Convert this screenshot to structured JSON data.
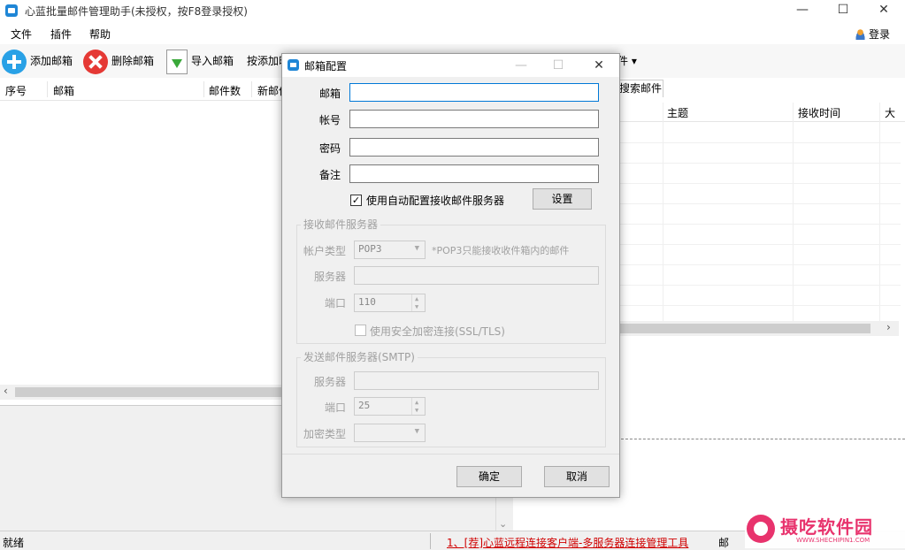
{
  "window": {
    "title": "心蓝批量邮件管理助手(未授权，按F8登录授权)",
    "controls": {
      "minimize": "—",
      "maximize": "☐",
      "close": "✕"
    }
  },
  "menu": {
    "items": [
      "文件",
      "插件",
      "帮助"
    ],
    "login": "登录"
  },
  "toolbar": {
    "add_label": "添加邮箱",
    "delete_label": "删除邮箱",
    "import_label": "导入邮箱",
    "add_by_label": "按添加时",
    "tail_label": "件 ▾"
  },
  "left_table": {
    "columns": [
      "序号",
      "邮箱",
      "邮件数",
      "新邮件"
    ]
  },
  "right_panel": {
    "tab": "搜索邮件",
    "columns": [
      "主题",
      "接收时间",
      "大"
    ]
  },
  "dialog": {
    "title": "邮箱配置",
    "fields": {
      "email_label": "邮箱",
      "email_value": "",
      "account_label": "帐号",
      "account_value": "",
      "password_label": "密码",
      "password_value": "",
      "note_label": "备注",
      "note_value": ""
    },
    "auto_config": {
      "checked": true,
      "label": "使用自动配置接收邮件服务器",
      "settings_button": "设置"
    },
    "receive_group": {
      "legend": "接收邮件服务器",
      "account_type_label": "帐户类型",
      "account_type_value": "POP3",
      "account_type_hint": "*POP3只能接收收件箱内的邮件",
      "server_label": "服务器",
      "server_value": "",
      "port_label": "端口",
      "port_value": "110",
      "ssl_checked": false,
      "ssl_label": "使用安全加密连接(SSL/TLS)"
    },
    "send_group": {
      "legend": "发送邮件服务器(SMTP)",
      "server_label": "服务器",
      "server_value": "",
      "port_label": "端口",
      "port_value": "25",
      "encryption_label": "加密类型",
      "encryption_value": ""
    },
    "ok_button": "确定",
    "cancel_button": "取消"
  },
  "statusbar": {
    "status": "就绪",
    "ad_link": "1、[荐]心蓝远程连接客户端-多服务器连接管理工具",
    "right_text": "邮"
  },
  "watermark": {
    "text": "摄吃软件园",
    "url": "WWW.SHECHIPIN1.COM"
  },
  "colors": {
    "accent": "#0078d7",
    "ad_link": "#d00000",
    "watermark": "#e8336d"
  }
}
